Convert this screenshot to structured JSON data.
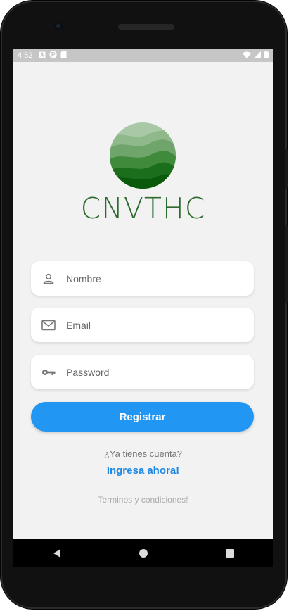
{
  "status_bar": {
    "time": "4:52",
    "left_icons": [
      "notification-a-icon",
      "notification-p-icon",
      "sd-card-icon"
    ],
    "right_icons": [
      "wifi-icon",
      "signal-icon",
      "battery-icon"
    ]
  },
  "brand": {
    "name": "CNVTHC"
  },
  "form": {
    "name_placeholder": "Nombre",
    "email_placeholder": "Email",
    "password_placeholder": "Password",
    "name_value": "",
    "email_value": "",
    "password_value": ""
  },
  "register_button": {
    "label": "Registrar"
  },
  "account_prompt": {
    "question": "¿Ya tienes cuenta?",
    "link": "Ingresa ahora!"
  },
  "terms": {
    "label": "Terminos y condiciones!"
  },
  "nav_bar": {
    "items": [
      "back-icon",
      "home-icon",
      "recents-icon"
    ]
  },
  "colors": {
    "accent": "#2196f3",
    "link": "#1e88e5",
    "brand": "#2f6b2f",
    "background": "#f2f2f2"
  }
}
